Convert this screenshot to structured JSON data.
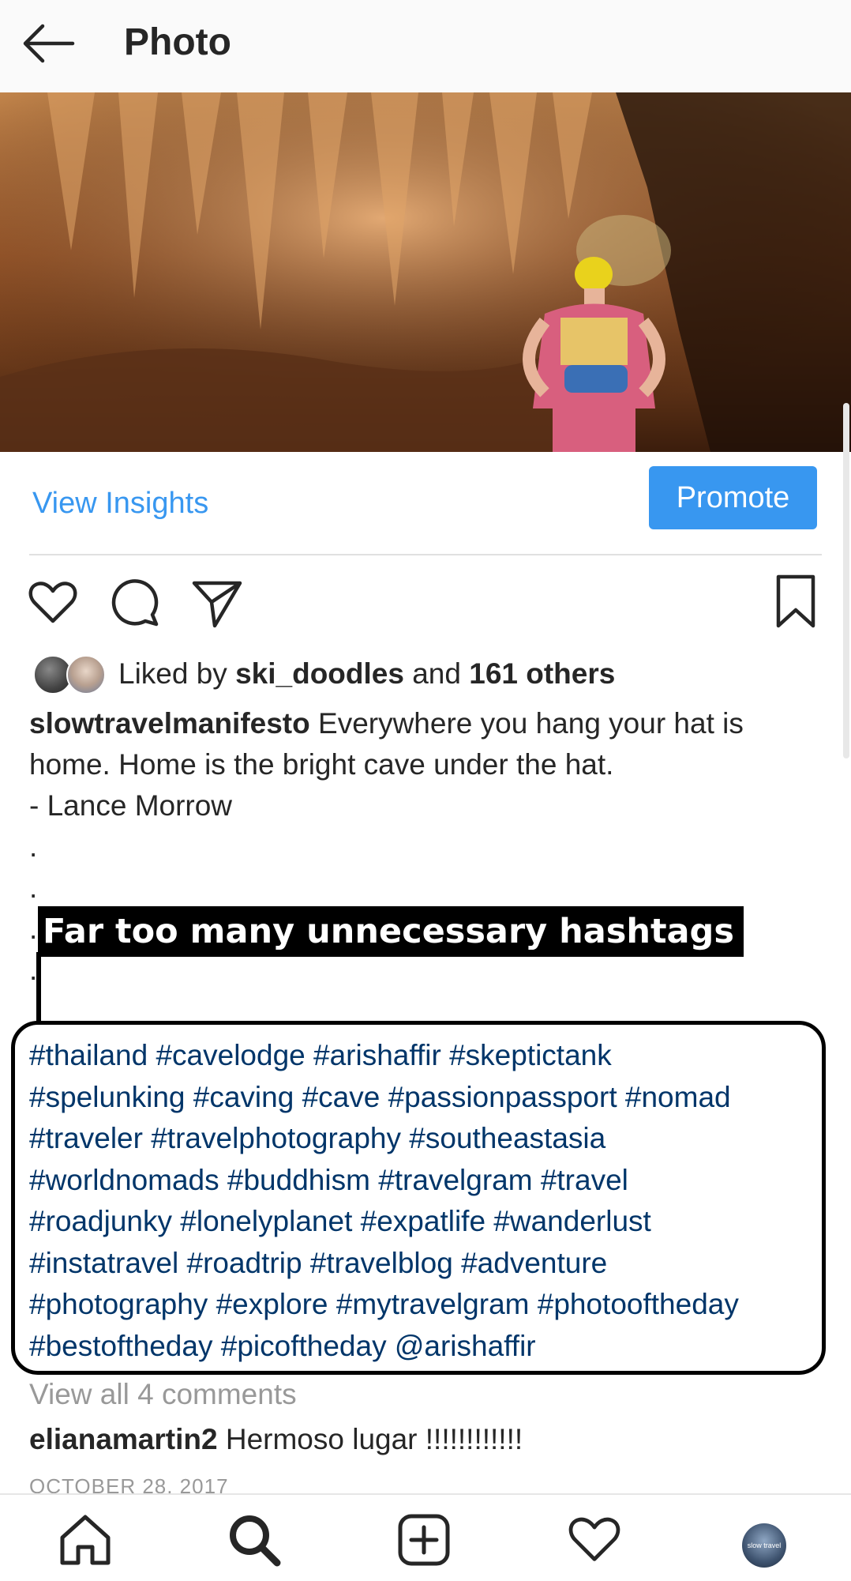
{
  "header": {
    "title": "Photo",
    "back_icon": "arrow-left-icon"
  },
  "insights": {
    "view_insights_label": "View Insights",
    "promote_label": "Promote"
  },
  "actions": {
    "like_icon": "heart-icon",
    "comment_icon": "comment-icon",
    "share_icon": "send-icon",
    "save_icon": "bookmark-icon"
  },
  "likes": {
    "prefix": "Liked by ",
    "user": "ski_doodles",
    "middle": " and ",
    "others": "161 others"
  },
  "caption": {
    "username": "slowtravelmanifesto",
    "line1": " Everywhere you hang your hat is",
    "line2": "home. Home is the bright cave under the hat.",
    "line3": "- Lance Morrow",
    "dot": "."
  },
  "annotation": {
    "label": "Far too many unnecessary hashtags"
  },
  "hashtags": [
    "#thailand #cavelodge #arishaffir #skeptictank",
    "#spelunking #caving #cave #passionpassport #nomad",
    "#traveler #travelphotography #southeastasia",
    "#worldnomads #buddhism #travelgram #travel",
    "#roadjunky #lonelyplanet #expatlife #wanderlust",
    "#instatravel #roadtrip #travelblog #adventure",
    "#photography #explore #mytravelgram #photooftheday",
    "#bestoftheday #picoftheday @arishaffir"
  ],
  "comments": {
    "view_all": "View all 4 comments",
    "items": [
      {
        "username": "elianamartin2",
        "text": " Hermoso lugar !!!!!!!!!!!!"
      }
    ],
    "date": "OCTOBER 28, 2017"
  },
  "bottom_nav": {
    "items": [
      "home-icon",
      "search-icon",
      "add-post-icon",
      "activity-heart-icon",
      "profile-avatar"
    ],
    "profile_avatar_text": "slow travel"
  },
  "colors": {
    "link_blue": "#3897f0",
    "hashtag_blue": "#003569",
    "muted_gray": "#999999"
  }
}
